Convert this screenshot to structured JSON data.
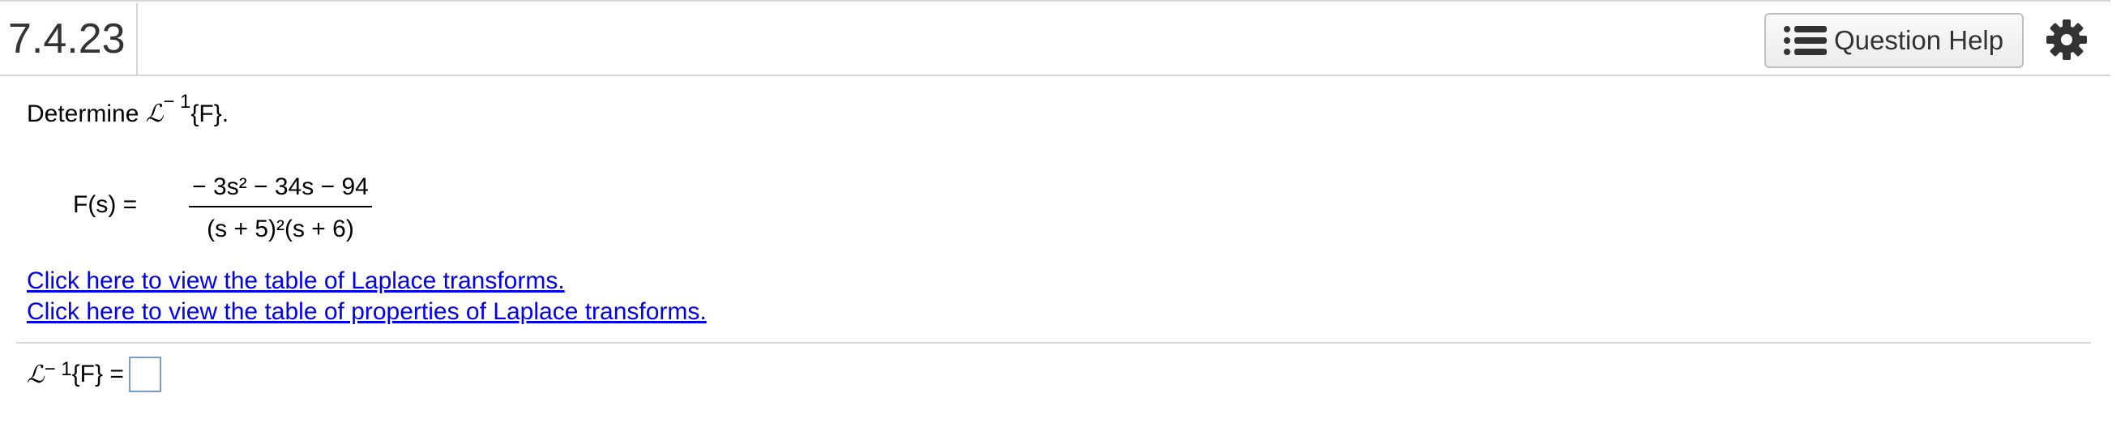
{
  "header": {
    "question_number": "7.4.23",
    "help_label": "Question Help",
    "help_icon": "list-icon",
    "settings_icon": "gear-icon"
  },
  "problem": {
    "prompt_word": "Determine ",
    "laplace_symbol": "ℒ",
    "inverse_superscript": "− 1",
    "prompt_arg": "{F}.",
    "lhs": "F(s) =",
    "numerator": "− 3s² − 34s − 94",
    "denominator": "(s + 5)²(s + 6)"
  },
  "links": {
    "laplace_table": "Click here to view the table of Laplace transforms.",
    "properties_table": "Click here to view the table of properties of Laplace transforms."
  },
  "answer": {
    "laplace_symbol": "ℒ",
    "inverse_superscript": "− 1",
    "lhs_arg": "{F} =",
    "value": ""
  },
  "colors": {
    "link": "#0000ee",
    "border": "#d6d6d6",
    "answer_box_border": "#7a9cc6"
  }
}
